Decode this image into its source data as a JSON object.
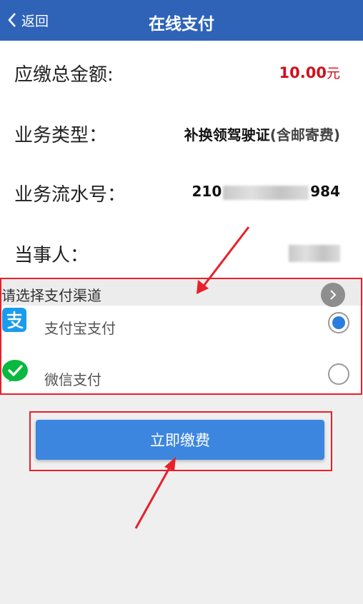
{
  "header": {
    "back_label": "返回",
    "title": "在线支付"
  },
  "info": {
    "amount": {
      "label": "应缴总金额:",
      "value": "10.00",
      "unit": "元"
    },
    "business_type": {
      "label": "业务类型：",
      "value": "补换领驾驶证",
      "note": "(含邮寄费)"
    },
    "serial_no": {
      "label": "业务流水号：",
      "prefix": "210",
      "suffix": "984"
    },
    "party": {
      "label": "当事人："
    }
  },
  "payment": {
    "header_label": "请选择支付渠道",
    "options": [
      {
        "label": "支付宝支付",
        "icon": "alipay-icon",
        "selected": true
      },
      {
        "label": "微信支付",
        "icon": "wechat-icon",
        "selected": false
      }
    ]
  },
  "pay_button_label": "立即缴费",
  "colors": {
    "header_bg": "#2e63b8",
    "amount": "#d0101d",
    "button": "#3c86e0",
    "annotation": "#e8202a",
    "alipay": "#1a9cee",
    "wechat": "#09b83e"
  }
}
